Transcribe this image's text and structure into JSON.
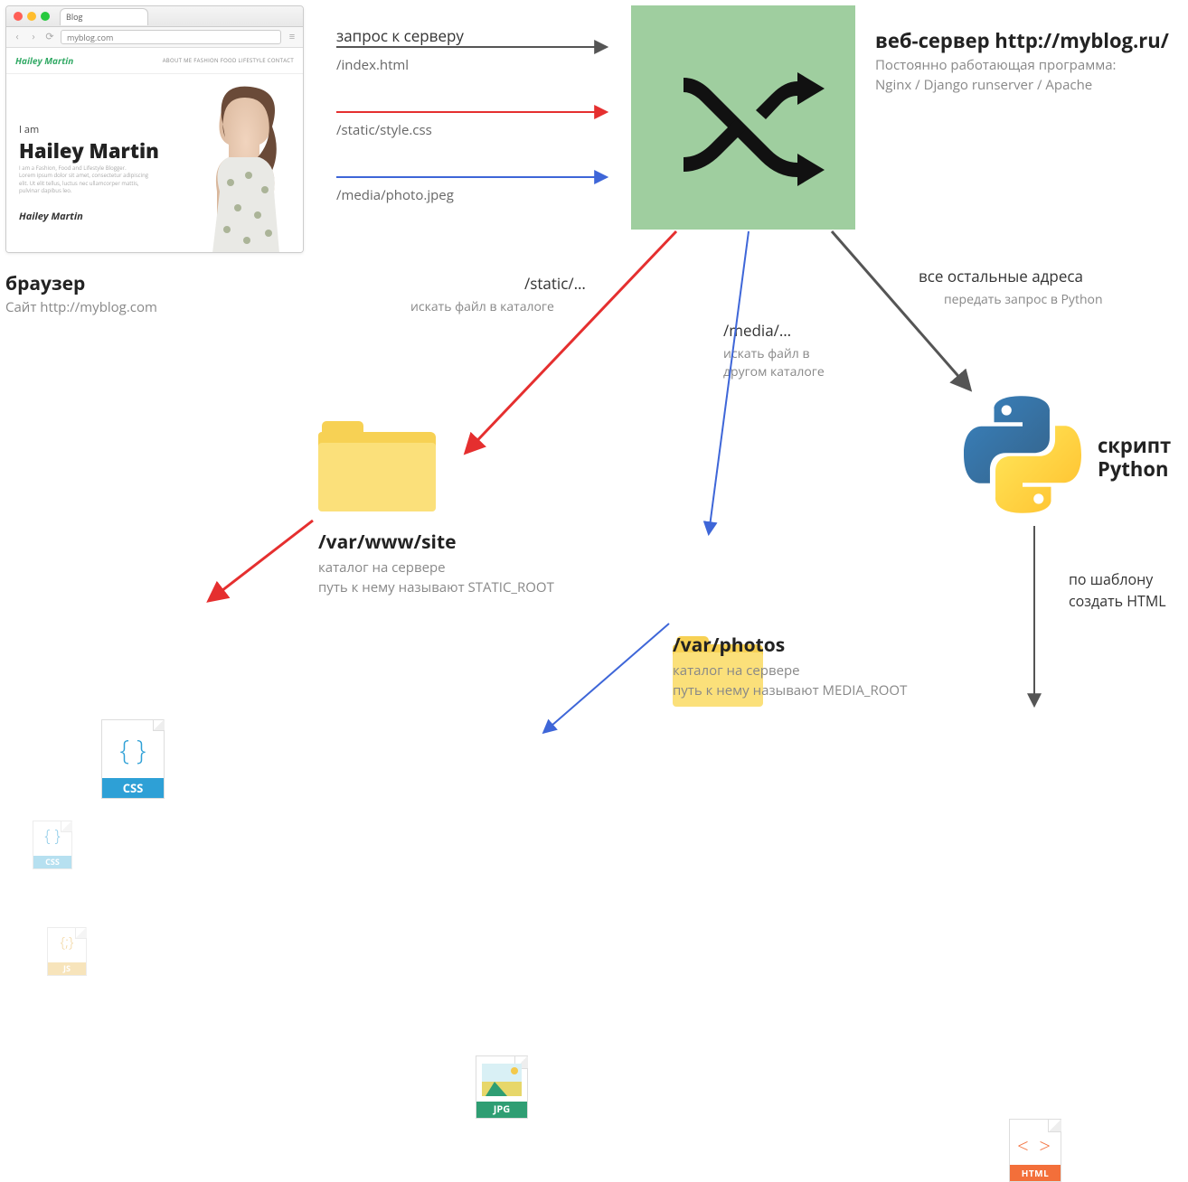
{
  "browser": {
    "tab_label": "Blog",
    "url": "myblog.com",
    "site_logo": "Hailey Martin",
    "menu": "ABOUT ME   FASHION   FOOD   LIFESTYLE   CONTACT",
    "hero_iam": "I am",
    "hero_name": "Hailey Martin",
    "hero_tag": "I am a Fashion, Food and Lifestyle Blogger.",
    "hero_desc": "Lorem ipsum dolor sit amet, consectetur adipiscing elit. Ut elit tellus, luctus nec ullamcorper mattis, pulvinar dapibus leo.",
    "hero_sig": "Hailey Martin",
    "title": "браузер",
    "subtitle": "Сайт http://myblog.com"
  },
  "requests": {
    "heading": "запрос к серверу",
    "r1": "/index.html",
    "r2": "/static/style.css",
    "r3": "/media/photo.jpeg"
  },
  "server": {
    "title": "веб-сервер http://myblog.ru/",
    "desc1": "Постоянно работающая программа:",
    "desc2": "Nginx / Django runserver / Apache"
  },
  "routes": {
    "static_label": "/static/…",
    "static_desc": "искать файл в каталоге",
    "media_label": "/media/…",
    "media_desc1": "искать файл в",
    "media_desc2": "другом каталоге",
    "other_label": "все остальные адреса",
    "other_desc": "передать запрос в Python"
  },
  "static_dir": {
    "path": "/var/www/site",
    "desc1": "каталог на сервере",
    "desc2": "путь к нему называют STATIC_ROOT"
  },
  "media_dir": {
    "path": "/var/photos",
    "desc1": "каталог на сервере",
    "desc2": "путь к нему называют MEDIA_ROOT"
  },
  "python": {
    "title1": "скрипт",
    "title2": "Python",
    "template1": "по шаблону",
    "template2": "создать HTML"
  },
  "file_labels": {
    "css": "CSS",
    "js": "JS",
    "jpg": "JPG",
    "html": "HTML"
  },
  "colors": {
    "dark": "#555",
    "red": "#e52f2f",
    "blue": "#3e66d8",
    "server_bg": "#9fce9f"
  }
}
